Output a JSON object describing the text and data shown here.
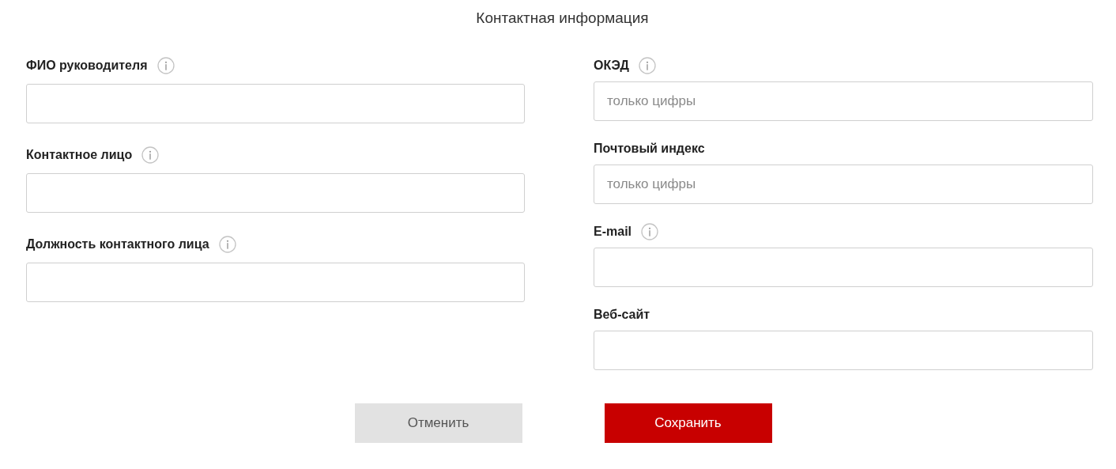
{
  "title": "Контактная информация",
  "columns": [
    {
      "fields": [
        {
          "label": "ФИО руководителя",
          "info": true
        },
        {
          "label": "Контактное лицо",
          "info": true
        },
        {
          "label": "Должность контактного лица",
          "info": true
        }
      ]
    },
    {
      "fields": [
        {
          "label": "ОКЭД",
          "info": true,
          "placeholder": "только цифры"
        },
        {
          "label": "Почтовый индекс",
          "info": false,
          "placeholder": "только цифры"
        },
        {
          "label": "E-mail",
          "info": true
        },
        {
          "label": "Веб-сайт",
          "info": false
        }
      ]
    }
  ],
  "buttons": [
    {
      "label": "Отменить",
      "kind": "secondary"
    },
    {
      "label": "Сохранить",
      "kind": "primary"
    }
  ]
}
